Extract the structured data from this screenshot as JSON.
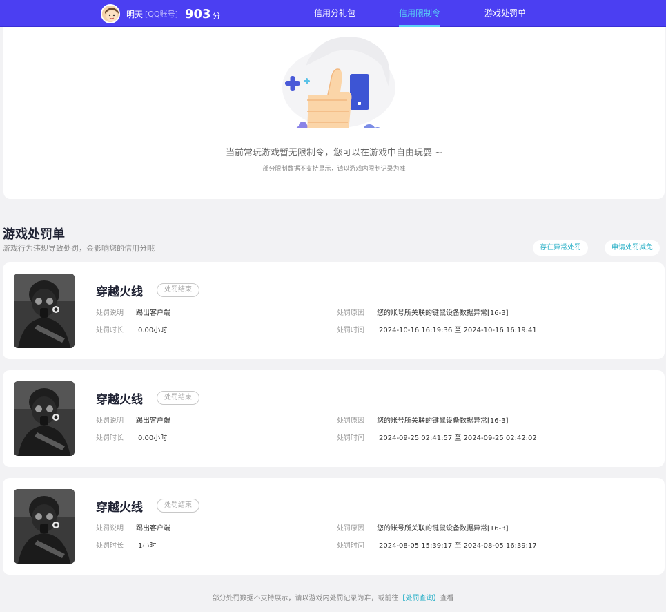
{
  "header": {
    "user_name": "明天",
    "account_type": "[QQ账号]",
    "score": "903",
    "score_unit": "分",
    "tabs": [
      {
        "label": "信用分礼包"
      },
      {
        "label": "信用限制令"
      },
      {
        "label": "游戏处罚单"
      }
    ],
    "active_tab": 1
  },
  "restriction": {
    "message": "当前常玩游戏暂无限制令，您可以在游戏中自由玩耍 ~",
    "note": "部分限制数据不支持显示，请以游戏内限制记录为准"
  },
  "penalty_section": {
    "title": "游戏处罚单",
    "description": "游戏行为违规导致处罚，会影响您的信用分哦",
    "btn_abnormal": "存在异常处罚",
    "btn_reduce": "申请处罚减免",
    "labels": {
      "explain": "处罚说明",
      "duration": "处罚时长",
      "reason": "处罚原因",
      "time": "处罚时间"
    },
    "records": [
      {
        "game": "穿越火线",
        "status": "处罚结束",
        "explain": "踢出客户端",
        "duration": "0.00小时",
        "reason": "您的账号所关联的键鼠设备数据异常[16-3]",
        "time": "2024-10-16 16:19:36 至 2024-10-16 16:19:41"
      },
      {
        "game": "穿越火线",
        "status": "处罚结束",
        "explain": "踢出客户端",
        "duration": "0.00小时",
        "reason": "您的账号所关联的键鼠设备数据异常[16-3]",
        "time": "2024-09-25 02:41:57 至 2024-09-25 02:42:02"
      },
      {
        "game": "穿越火线",
        "status": "处罚结束",
        "explain": "踢出客户端",
        "duration": "1小时",
        "reason": "您的账号所关联的键鼠设备数据异常[16-3]",
        "time": "2024-08-05 15:39:17 至 2024-08-05 16:39:17"
      }
    ]
  },
  "footer": {
    "text_before": "部分处罚数据不支持展示，请以游戏内处罚记录为准，或前往",
    "link": "【处罚查询】",
    "text_after": "查看"
  },
  "icons": {
    "avatar": "cartoon-avatar-icon",
    "illustration": "thumbs-up-illustration",
    "game_thumb": "soldier-gasmask-image"
  },
  "colors": {
    "header_bg": "#4b3ff2",
    "active_tab": "#5ad0f5",
    "link": "#2ab0c7"
  }
}
